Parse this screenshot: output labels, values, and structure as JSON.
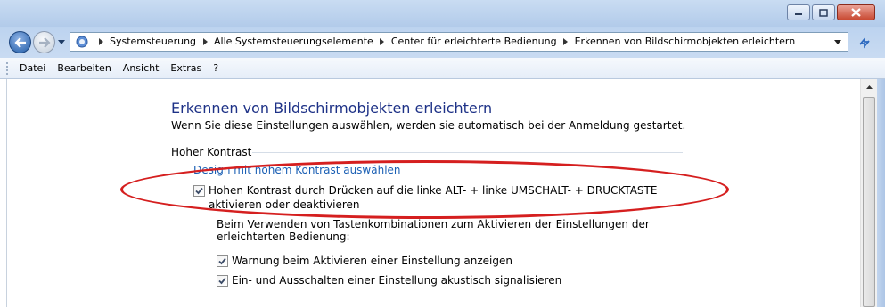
{
  "window": {
    "buttons": [
      "minimize",
      "maximize",
      "close"
    ]
  },
  "address": {
    "breadcrumbs": [
      "Systemsteuerung",
      "Alle Systemsteuerungselemente",
      "Center für erleichterte Bedienung",
      "Erkennen von Bildschirmobjekten erleichtern"
    ]
  },
  "menu": {
    "items": [
      "Datei",
      "Bearbeiten",
      "Ansicht",
      "Extras",
      "?"
    ]
  },
  "content": {
    "title": "Erkennen von Bildschirmobjekten erleichtern",
    "subtitle": "Wenn Sie diese Einstellungen auswählen, werden sie automatisch bei der Anmeldung gestartet.",
    "section_title": "Hoher Kontrast",
    "link": "Design mit hohem Kontrast auswählen",
    "hc_toggle": {
      "label": "Hohen Kontrast durch Drücken auf die linke ALT- + linke UMSCHALT- + DRUCKTASTE aktivieren oder deaktivieren",
      "checked": true
    },
    "shortcut_paragraph": "Beim Verwenden von Tastenkombinationen zum Aktivieren der Einstellungen der erleichterten Bedienung:",
    "option_warning": {
      "label": "Warnung beim Aktivieren einer Einstellung anzeigen",
      "checked": true
    },
    "option_sound": {
      "label": "Ein- und Ausschalten einer Einstellung akustisch signalisieren",
      "checked": true
    }
  },
  "colors": {
    "heading": "#1e3287",
    "link": "#1a5fb4",
    "highlight_ellipse": "#d51f1f"
  },
  "icons": {
    "back": "arrow-left-icon",
    "forward": "arrow-right-icon",
    "address_icon": "control-panel-icon",
    "breadcrumb_separator": "chevron-right-icon",
    "refresh": "refresh-icon"
  }
}
